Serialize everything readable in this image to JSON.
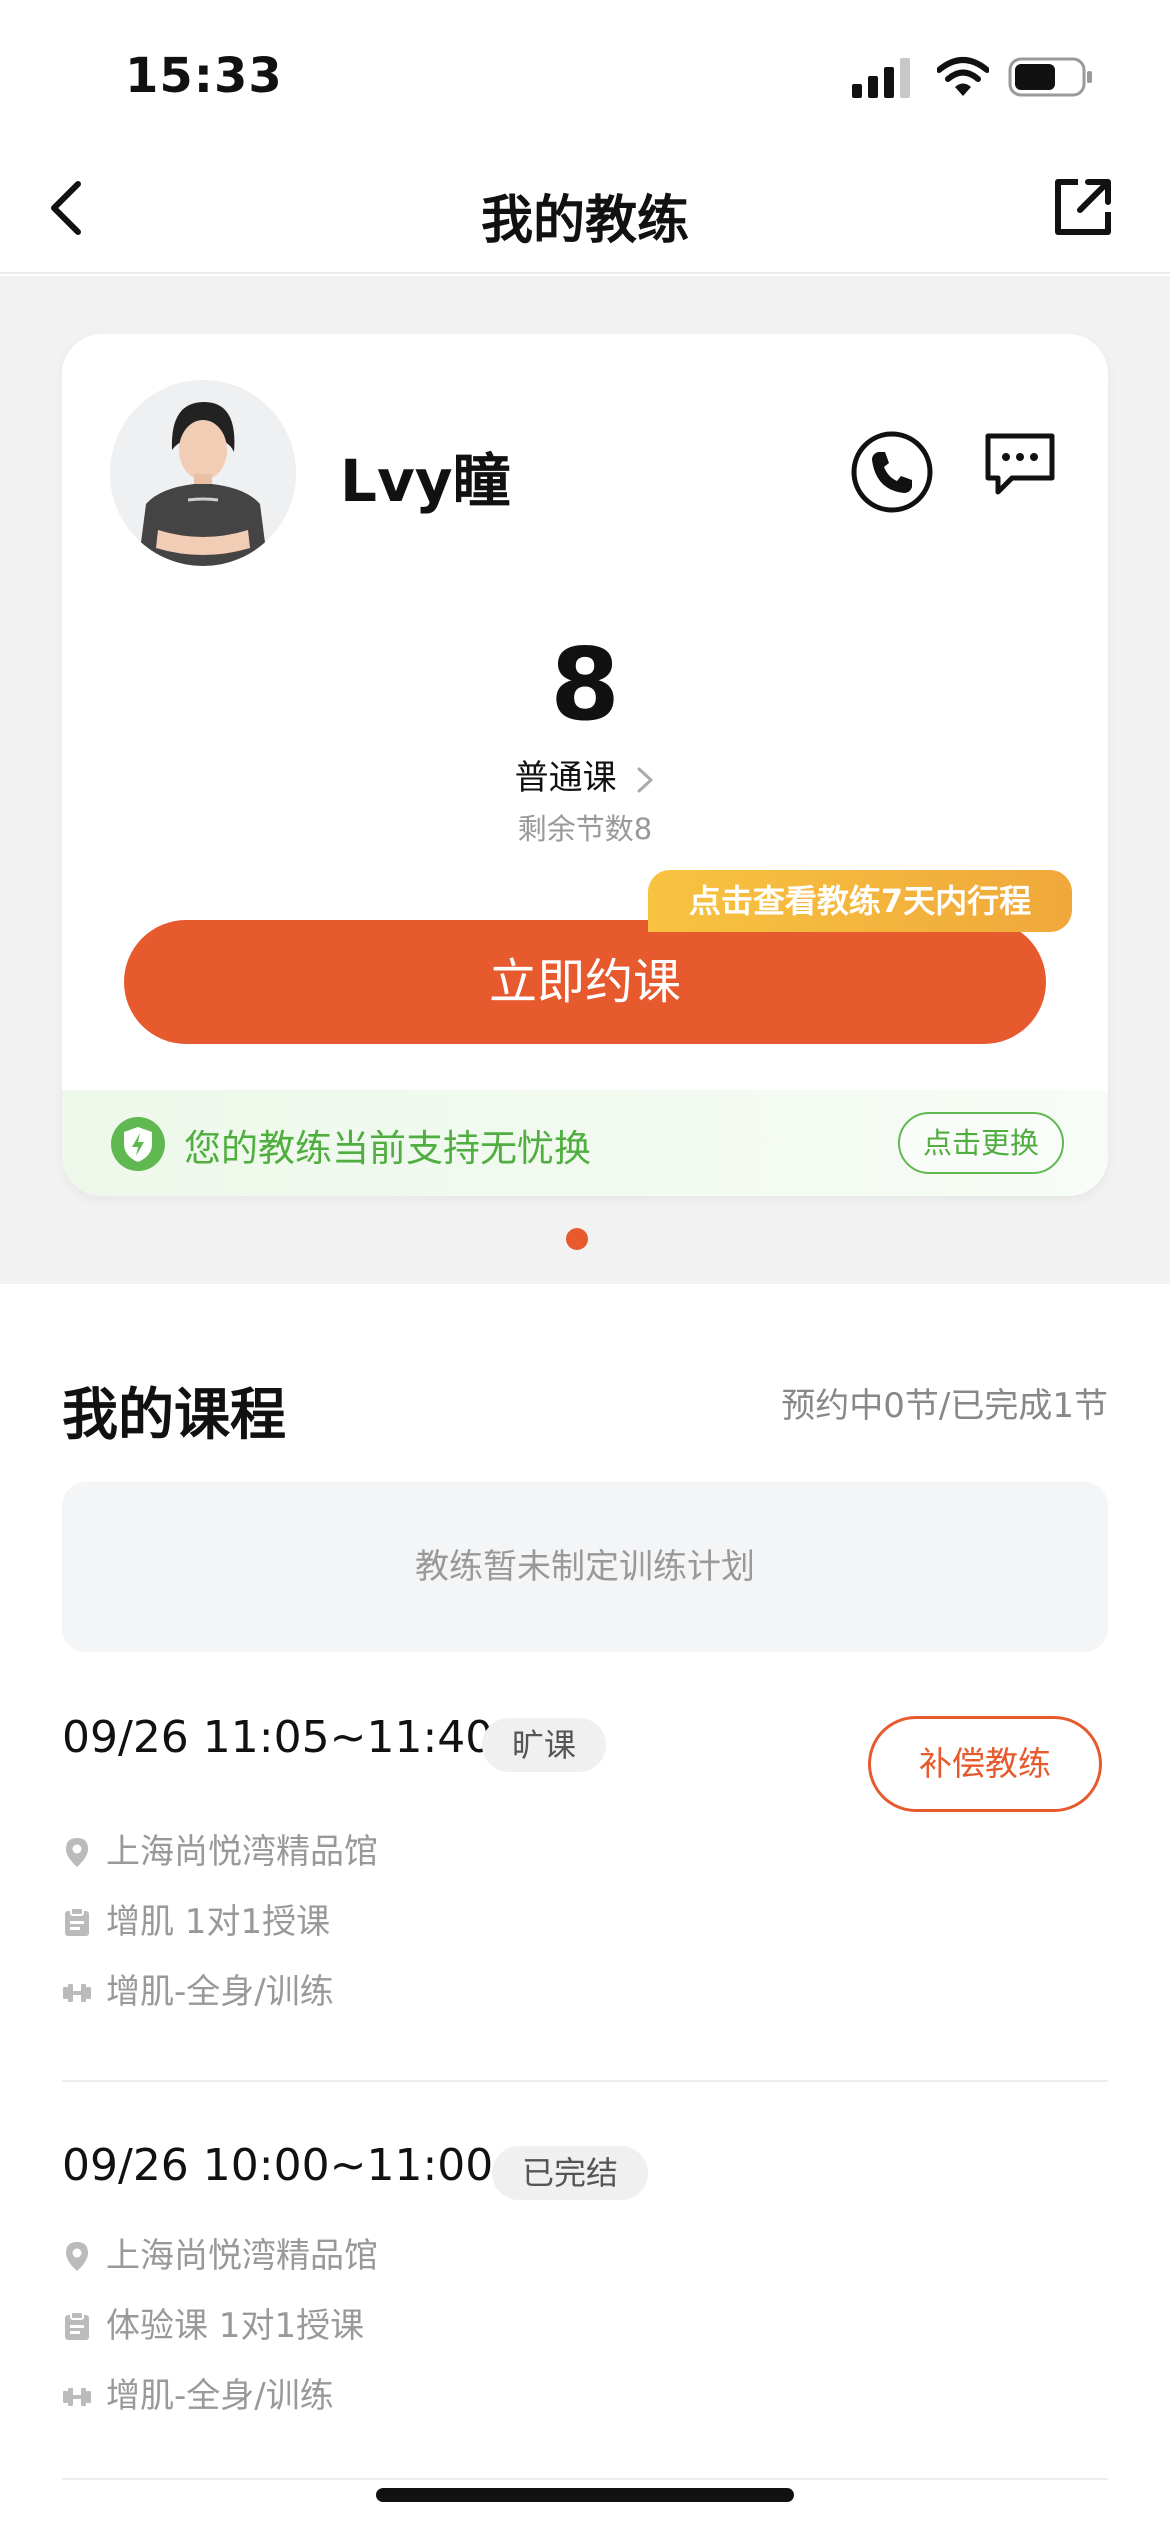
{
  "status_bar": {
    "time": "15:33"
  },
  "nav": {
    "title": "我的教练"
  },
  "coach": {
    "name": "Lvy瞳",
    "remaining_count": "8",
    "course_type": "普通课",
    "remaining_text": "剩余节数8",
    "schedule_tip": "点击查看教练7天内行程",
    "book_button": "立即约课",
    "guarantee_text": "您的教练当前支持无忧换",
    "change_button": "点击更换"
  },
  "courses": {
    "header": "我的课程",
    "summary": "预约中0节/已完成1节",
    "plan_empty": "教练暂未制定训练计划",
    "items": [
      {
        "time": "09/26 11:05~11:40",
        "status": "旷课",
        "action": "补偿教练",
        "location": "上海尚悦湾精品馆",
        "course": "增肌 1对1授课",
        "training": "增肌-全身/训练"
      },
      {
        "time": "09/26 10:00~11:00",
        "status": "已完结",
        "location": "上海尚悦湾精品馆",
        "course": "体验课 1对1授课",
        "training": "增肌-全身/训练"
      }
    ]
  },
  "colors": {
    "accent": "#e65a2e",
    "tip_gradient": [
      "#f7c340",
      "#f0a83a"
    ],
    "guarantee_green": "#4fae3f",
    "background_gray": "#f2f2f2"
  },
  "icons": {
    "back": "back-icon",
    "share": "share-icon",
    "phone": "phone-icon",
    "message": "message-icon",
    "shield": "shield-icon",
    "location": "location-icon",
    "clipboard": "clipboard-icon",
    "dumbbell": "dumbbell-icon"
  }
}
